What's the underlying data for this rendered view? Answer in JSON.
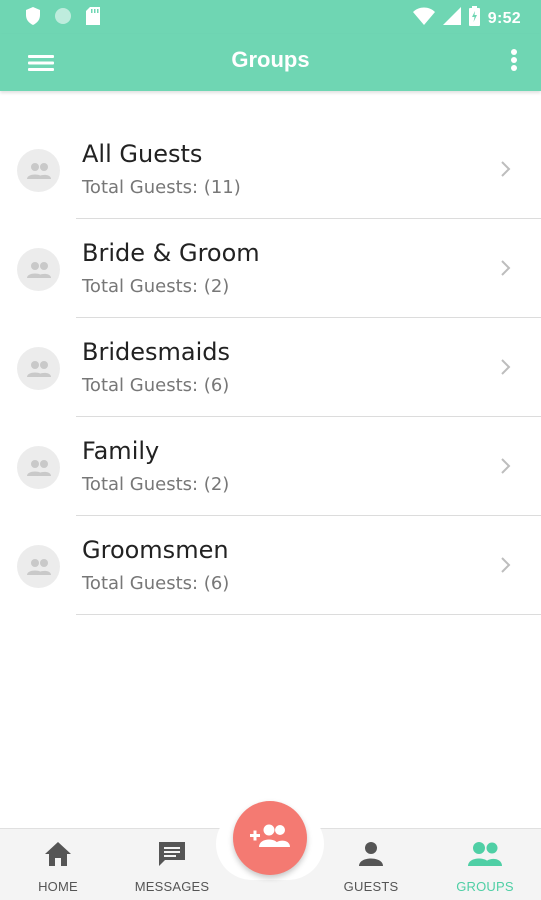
{
  "status_bar": {
    "time": "9:52",
    "icons": [
      "shield-icon",
      "circle-icon",
      "sd-card-icon",
      "wifi-icon",
      "signal-icon",
      "battery-icon"
    ]
  },
  "app_bar": {
    "title": "Groups",
    "menu_icon": "hamburger-menu-icon",
    "more_icon": "more-vertical-icon"
  },
  "groups": [
    {
      "name": "All Guests",
      "count": "Total Guests: (11)"
    },
    {
      "name": "Bride & Groom",
      "count": "Total Guests: (2)"
    },
    {
      "name": "Bridesmaids",
      "count": "Total Guests: (6)"
    },
    {
      "name": "Family",
      "count": "Total Guests: (2)"
    },
    {
      "name": "Groomsmen",
      "count": "Total Guests: (6)"
    }
  ],
  "fab": {
    "icon": "add-group-icon"
  },
  "bottom_nav": {
    "items": [
      {
        "label": "HOME",
        "icon": "home-icon"
      },
      {
        "label": "MESSAGES",
        "icon": "message-icon"
      },
      {
        "label": "GUESTS",
        "icon": "person-icon"
      },
      {
        "label": "GROUPS",
        "icon": "groups-icon",
        "active": true
      }
    ]
  },
  "colors": {
    "primary": "#6fd6b3",
    "fab": "#f47a72",
    "active_nav": "#4fcfa5"
  }
}
